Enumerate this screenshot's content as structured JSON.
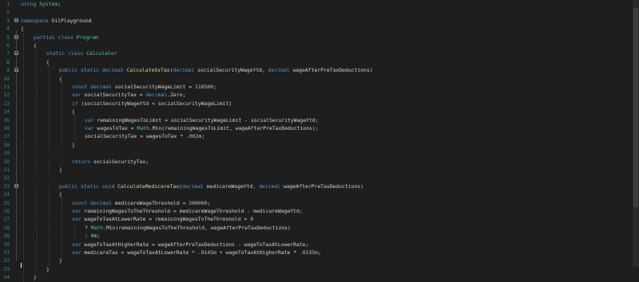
{
  "lines": [
    {
      "n": "1",
      "fold": false,
      "indent": 0,
      "code": "using System;"
    },
    {
      "n": "2",
      "fold": false,
      "indent": 0,
      "code": ""
    },
    {
      "n": "3",
      "fold": true,
      "indent": 0,
      "code": "namespace GilPlayground"
    },
    {
      "n": "4",
      "fold": false,
      "indent": 0,
      "code": "{"
    },
    {
      "n": "5",
      "fold": true,
      "indent": 1,
      "code": "partial class Program"
    },
    {
      "n": "6",
      "fold": false,
      "indent": 1,
      "code": "{"
    },
    {
      "n": "7",
      "fold": true,
      "indent": 2,
      "code": "static class Calculator"
    },
    {
      "n": "8",
      "fold": false,
      "indent": 2,
      "code": "{"
    },
    {
      "n": "9",
      "fold": true,
      "indent": 3,
      "code": "public static decimal CalculateSsTax(decimal socialSecurityWageYtd, decimal wageAfterPreTaxDeductions)"
    },
    {
      "n": "10",
      "fold": false,
      "indent": 3,
      "code": "{"
    },
    {
      "n": "11",
      "fold": false,
      "indent": 4,
      "code": "const decimal socialSecurityWageLimit = 118500;"
    },
    {
      "n": "12",
      "fold": false,
      "indent": 4,
      "code": "var socialSecurityTax = decimal.Zero;"
    },
    {
      "n": "13",
      "fold": false,
      "indent": 4,
      "code": "if (socialSecurityWageYtd < socialSecurityWageLimit)"
    },
    {
      "n": "14",
      "fold": false,
      "indent": 4,
      "code": "{"
    },
    {
      "n": "15",
      "fold": false,
      "indent": 5,
      "code": "var remainingWagesToLimit = socialSecurityWageLimit - socialSecurityWageYtd;"
    },
    {
      "n": "16",
      "fold": false,
      "indent": 5,
      "code": "var wagesToTax = Math.Min(remainingWagesToLimit, wageAfterPreTaxDeductions);"
    },
    {
      "n": "17",
      "fold": false,
      "indent": 5,
      "code": "socialSecurityTax = wagesToTax * .062m;"
    },
    {
      "n": "18",
      "fold": false,
      "indent": 4,
      "code": "}"
    },
    {
      "n": "19",
      "fold": false,
      "indent": 0,
      "code": ""
    },
    {
      "n": "20",
      "fold": false,
      "indent": 4,
      "code": "return socialSecurityTax;"
    },
    {
      "n": "21",
      "fold": false,
      "indent": 3,
      "code": "}"
    },
    {
      "n": "22",
      "fold": false,
      "indent": 0,
      "code": ""
    },
    {
      "n": "23",
      "fold": true,
      "indent": 3,
      "code": "public static void CalculateMedicareTax(decimal medicareWageYtd, decimal wageAfterPreTaxDeductions)"
    },
    {
      "n": "24",
      "fold": false,
      "indent": 3,
      "code": "{"
    },
    {
      "n": "25",
      "fold": false,
      "indent": 4,
      "code": "const decimal medicareWageThreshold = 200000;"
    },
    {
      "n": "26",
      "fold": false,
      "indent": 4,
      "code": "var remainingWagesToTheThreshold = medicareWageThreshold - medicareWageYtd;"
    },
    {
      "n": "27",
      "fold": false,
      "indent": 4,
      "code": "var wageToTaxAtLowerRate = remainingWagesToTheThreshold > 0"
    },
    {
      "n": "28",
      "fold": false,
      "indent": 5,
      "code": "? Math.Min(remainingWagesToTheThreshold, wageAfterPreTaxDeductions)"
    },
    {
      "n": "29",
      "fold": false,
      "indent": 5,
      "code": ": 0m;"
    },
    {
      "n": "30",
      "fold": false,
      "indent": 4,
      "code": "var wageToTaxAtHigherRate = wageAfterPreTaxDeductions - wageToTaxAtLowerRate;"
    },
    {
      "n": "31",
      "fold": false,
      "indent": 4,
      "code": "var medicareTax = wageToTaxAtLowerRate * .0145m + wageToTaxAtHigherRate * .0235m;"
    },
    {
      "n": "32",
      "fold": false,
      "indent": 3,
      "code": "}"
    },
    {
      "n": "33",
      "fold": false,
      "indent": 2,
      "code": "}"
    },
    {
      "n": "34",
      "fold": false,
      "indent": 1,
      "code": "}"
    }
  ],
  "colors": {
    "background": "#1e1e1e",
    "keyword": "#569cd6",
    "type": "#4ec9b0",
    "number": "#b5cea8",
    "method": "#dcdcaa",
    "identifier": "#9cdcfe",
    "lineNumber": "#2b91af"
  },
  "icons": {
    "fold": "collapse-box-icon"
  }
}
